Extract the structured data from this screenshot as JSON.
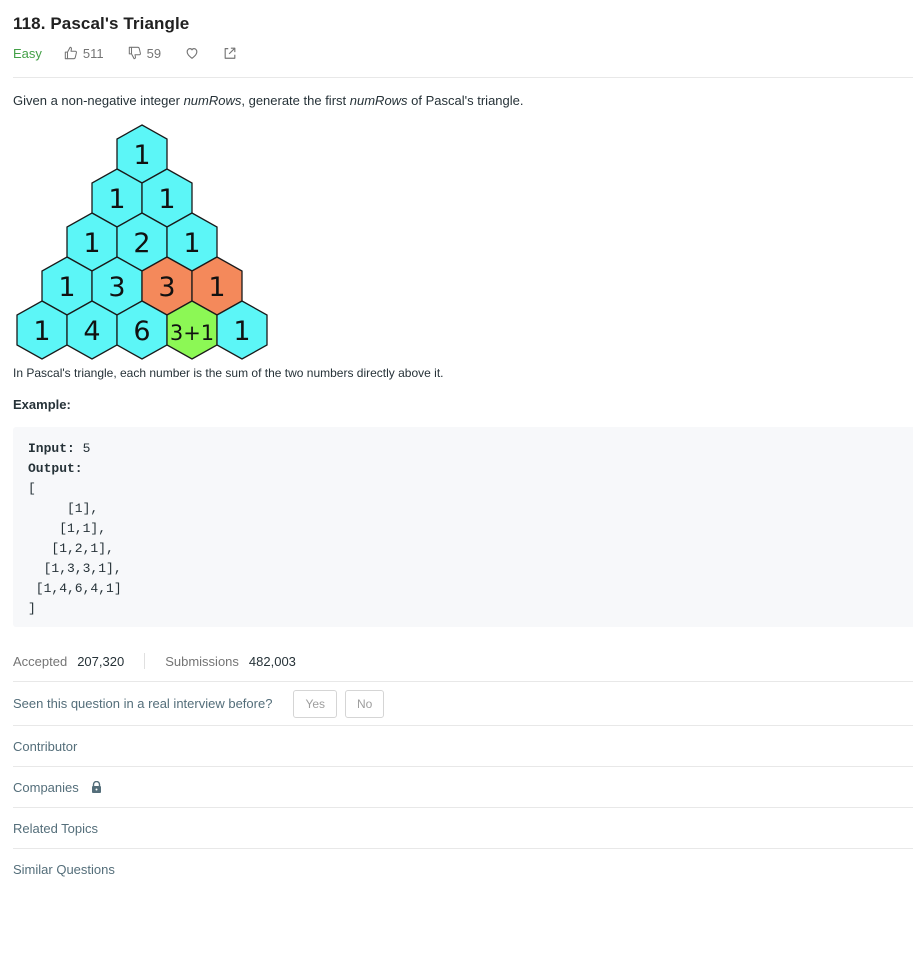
{
  "problem": {
    "title": "118. Pascal's Triangle",
    "difficulty": "Easy",
    "likes": "511",
    "dislikes": "59"
  },
  "description": {
    "intro_prefix": "Given a non-negative integer ",
    "intro_var1": "numRows",
    "intro_middle": ", generate the first ",
    "intro_var2": "numRows",
    "intro_suffix": " of Pascal's triangle.",
    "caption": "In Pascal's triangle, each number is the sum of the two numbers directly above it."
  },
  "triangle": {
    "rows": [
      [
        "1"
      ],
      [
        "1",
        "1"
      ],
      [
        "1",
        "2",
        "1"
      ],
      [
        "1",
        "3",
        "3",
        "1"
      ],
      [
        "1",
        "4",
        "6",
        "3+1",
        "1"
      ]
    ],
    "highlight_orange": [
      [
        3,
        2
      ],
      [
        3,
        3
      ]
    ],
    "highlight_green": [
      [
        4,
        3
      ]
    ],
    "colors": {
      "default": "#5cf6f7",
      "orange": "#f4895b",
      "green": "#8cf855",
      "stroke": "#1a1a1a"
    }
  },
  "example": {
    "label": "Example:",
    "input_label": "Input:",
    "input_value": " 5",
    "output_label": "Output:",
    "output_lines": [
      "[",
      "     [1],",
      "    [1,1],",
      "   [1,2,1],",
      "  [1,3,3,1],",
      " [1,4,6,4,1]",
      "]"
    ]
  },
  "stats": {
    "accepted_label": "Accepted",
    "accepted_value": "207,320",
    "submissions_label": "Submissions",
    "submissions_value": "482,003"
  },
  "interview": {
    "question": "Seen this question in a real interview before?",
    "yes": "Yes",
    "no": "No"
  },
  "sections": {
    "contributor": "Contributor",
    "companies": "Companies",
    "related_topics": "Related Topics",
    "similar_questions": "Similar Questions"
  },
  "colors": {
    "easy": "#43a047",
    "muted": "#757575",
    "code_bg": "#f7f8fa"
  }
}
